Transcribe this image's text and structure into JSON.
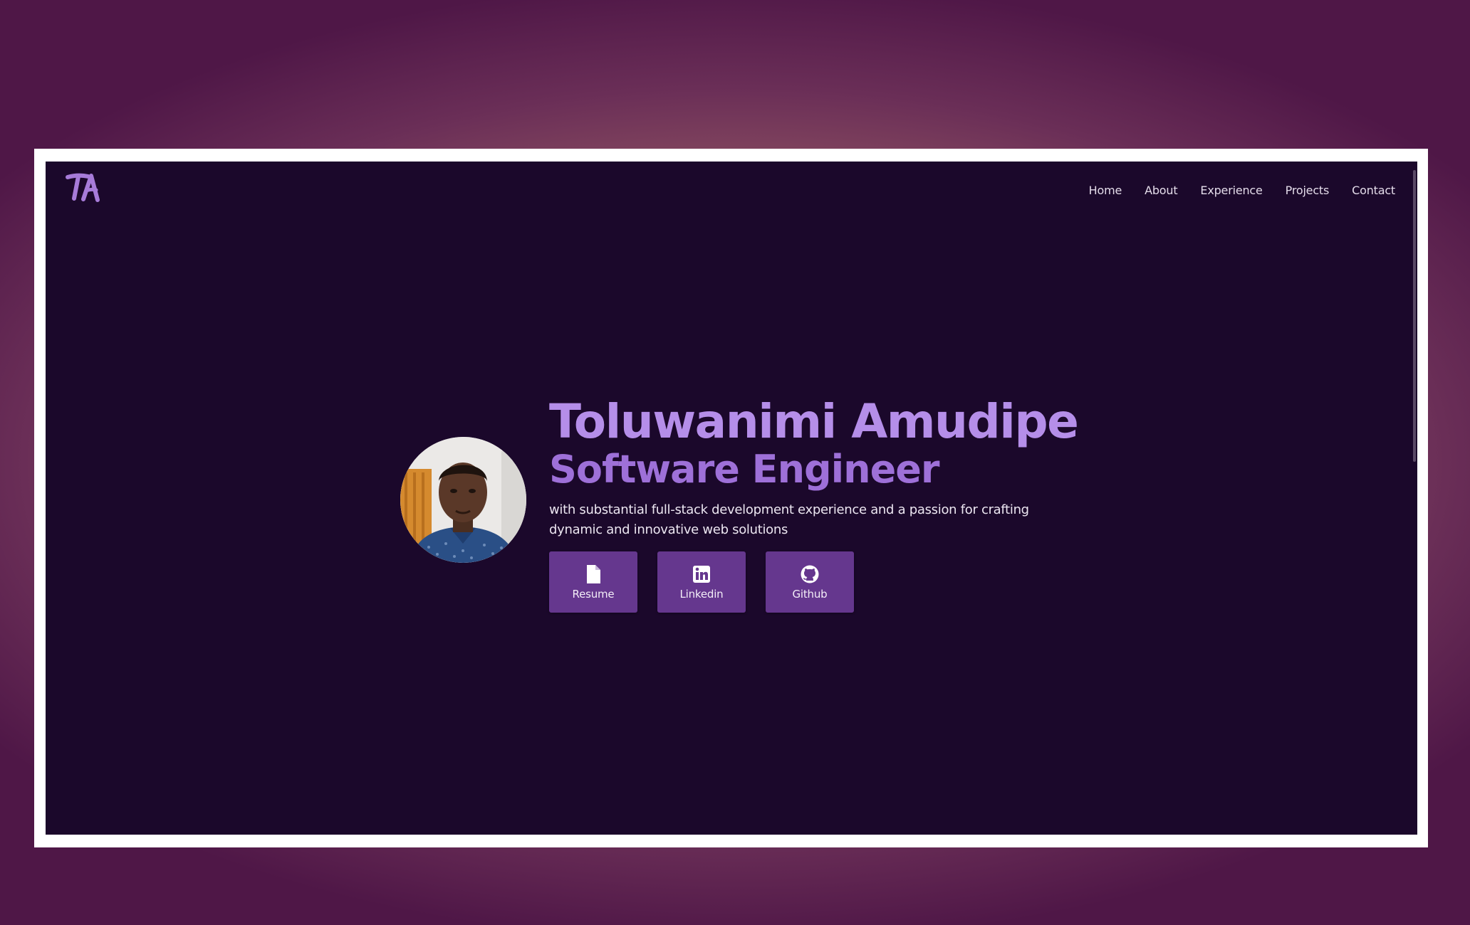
{
  "logo": {
    "text": "TA",
    "color": "#a77bd9",
    "icon": "ta-monogram-logo"
  },
  "nav": {
    "items": [
      {
        "label": "Home"
      },
      {
        "label": "About"
      },
      {
        "label": "Experience"
      },
      {
        "label": "Projects"
      },
      {
        "label": "Contact"
      }
    ]
  },
  "hero": {
    "name": "Toluwanimi Amudipe",
    "role": "Software Engineer",
    "tagline": "with substantial full-stack development experience and a passion for crafting dynamic and innovative web solutions",
    "avatar_icon": "profile-photo",
    "buttons": [
      {
        "label": "Resume",
        "icon": "document-icon"
      },
      {
        "label": "Linkedin",
        "icon": "linkedin-icon"
      },
      {
        "label": "Github",
        "icon": "github-icon"
      }
    ]
  },
  "colors": {
    "page_background": "#1b082b",
    "name": "#b58ee9",
    "role": "#9e70d8",
    "button": "#65378e",
    "frame": "#ffffff"
  }
}
